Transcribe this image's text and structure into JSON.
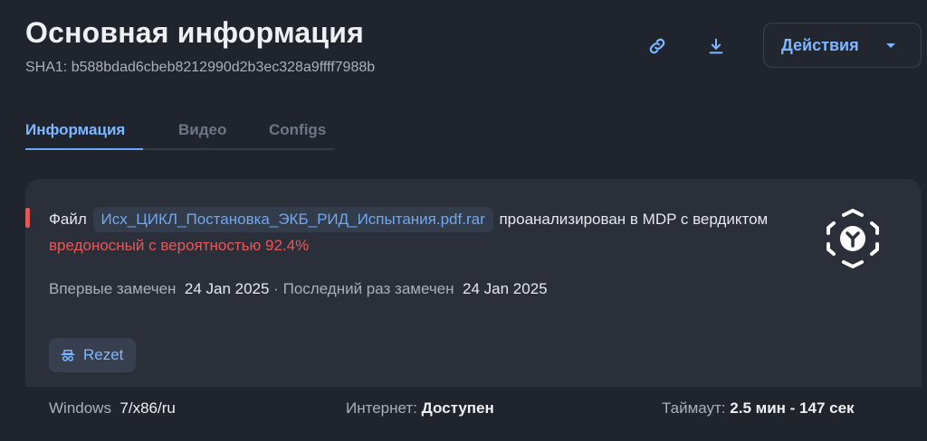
{
  "header": {
    "title": "Основная информация",
    "sha1": "SHA1: b588bdad6cbeb8212990d2b3ec328a9ffff7988b",
    "actions_label": "Действия",
    "link_icon": "link-icon",
    "download_icon": "download-icon"
  },
  "tabs": [
    {
      "label": "Информация",
      "active": true
    },
    {
      "label": "Видео",
      "active": false
    },
    {
      "label": "Configs",
      "active": false
    }
  ],
  "summary": {
    "prefix": "Файл",
    "file_name": "Исх_ЦИКЛ_Постановка_ЭКБ_РИД_Испытания.pdf.rar",
    "middle": "проанализирован в MDP с вердиктом",
    "verdict": "вредоносный с вероятностью 92.4%"
  },
  "seen": {
    "first_label": "Впервые замечен",
    "first_date": "24 Jan 2025",
    "separator": "·",
    "last_label": "Последний раз замечен",
    "last_date": "24 Jan 2025"
  },
  "tag": {
    "label": "Rezet"
  },
  "environment": {
    "os_label": "Windows",
    "os_value": "7/x86/ru",
    "internet_label": "Интернет:",
    "internet_value": "Доступен",
    "timeout_label": "Таймаут:",
    "timeout_value": "2.5 мин - 147 сек"
  },
  "colors": {
    "accent": "#7fb6ff",
    "verdict_red": "#e8585a",
    "background": "#20242d",
    "card": "#2a2f39"
  }
}
